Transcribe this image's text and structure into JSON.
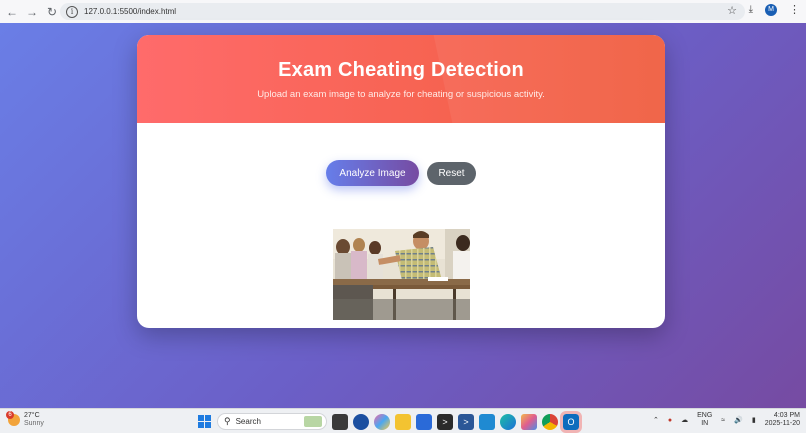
{
  "browser": {
    "url": "127.0.0.1:5500/index.html",
    "profile_initial": "M"
  },
  "header": {
    "title": "Exam Cheating Detection",
    "subtitle": "Upload an exam image to analyze for cheating or suspicious activity."
  },
  "actions": {
    "analyze_label": "Analyze Image",
    "reset_label": "Reset"
  },
  "colors": {
    "header_gradient": [
      "#ff6b6b",
      "#f05d3e"
    ],
    "background_gradient": [
      "#6a7ee6",
      "#764ba2"
    ],
    "primary_button": [
      "#667eea",
      "#764ba2"
    ],
    "secondary_button": "#5d646b"
  },
  "taskbar": {
    "weather_temp": "27°C",
    "weather_desc": "Sunny",
    "weather_badge": "6",
    "search_label": "Search",
    "lang_top": "ENG",
    "lang_bottom": "IN",
    "time": "4:03 PM",
    "date": "2025-11-20",
    "app_icons": [
      "windows-start-icon",
      "search-icon",
      "file-explorer-icon",
      "store-icon",
      "terminal-icon",
      "vscode-icon",
      "edge-icon",
      "chrome-icon",
      "outlook-icon"
    ]
  }
}
